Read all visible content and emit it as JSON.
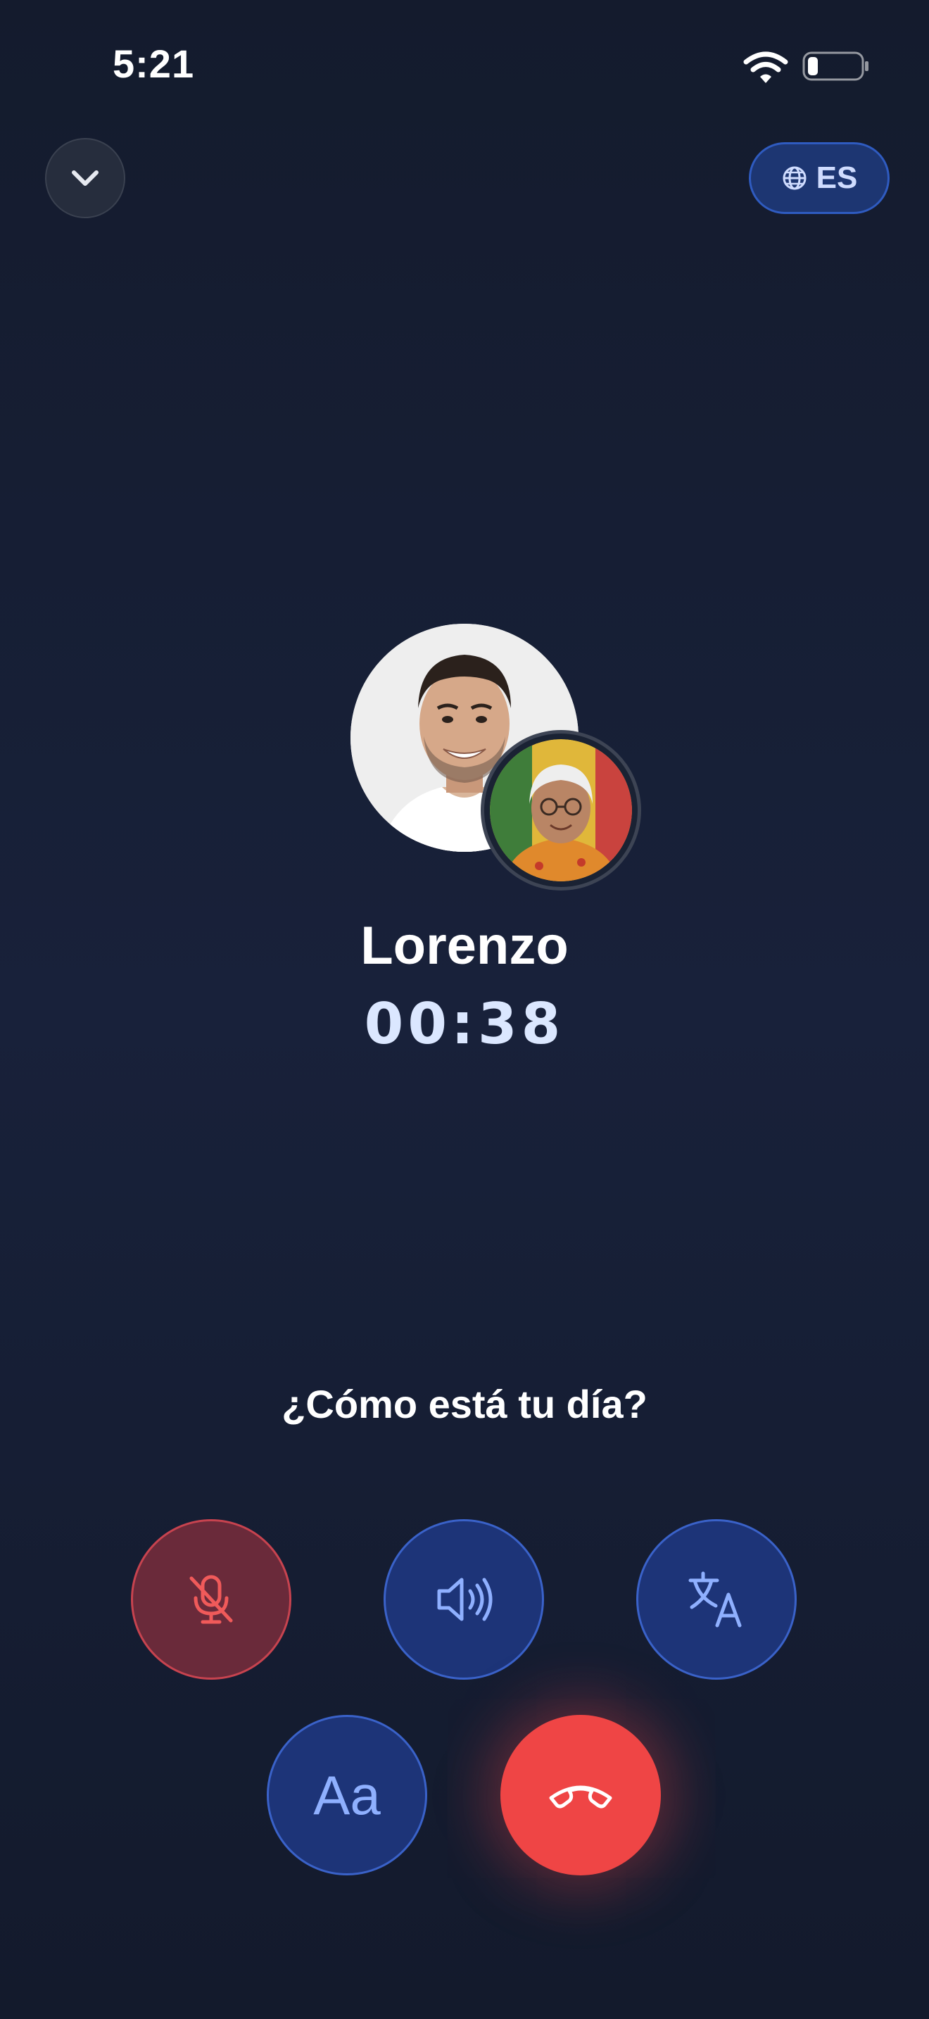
{
  "status_bar": {
    "time": "5:21",
    "icons": [
      "wifi-icon",
      "battery-icon"
    ]
  },
  "top_bar": {
    "collapse_icon": "chevron-down-icon",
    "language": {
      "icon": "globe-icon",
      "code": "ES"
    }
  },
  "call": {
    "caller_name": "Lorenzo",
    "duration": "00:38",
    "caption": "¿Cómo está tu día?"
  },
  "controls": {
    "mute": {
      "icon": "microphone-off-icon",
      "active": true
    },
    "speaker": {
      "icon": "speaker-icon"
    },
    "translate": {
      "icon": "translate-icon"
    },
    "text_size": {
      "label": "Aa"
    },
    "hangup": {
      "icon": "phone-hangup-icon"
    }
  },
  "colors": {
    "background": "#18213a",
    "accent_blue": "#1d3478",
    "danger": "#ef4545",
    "mute_active": "#6a2a3a"
  }
}
